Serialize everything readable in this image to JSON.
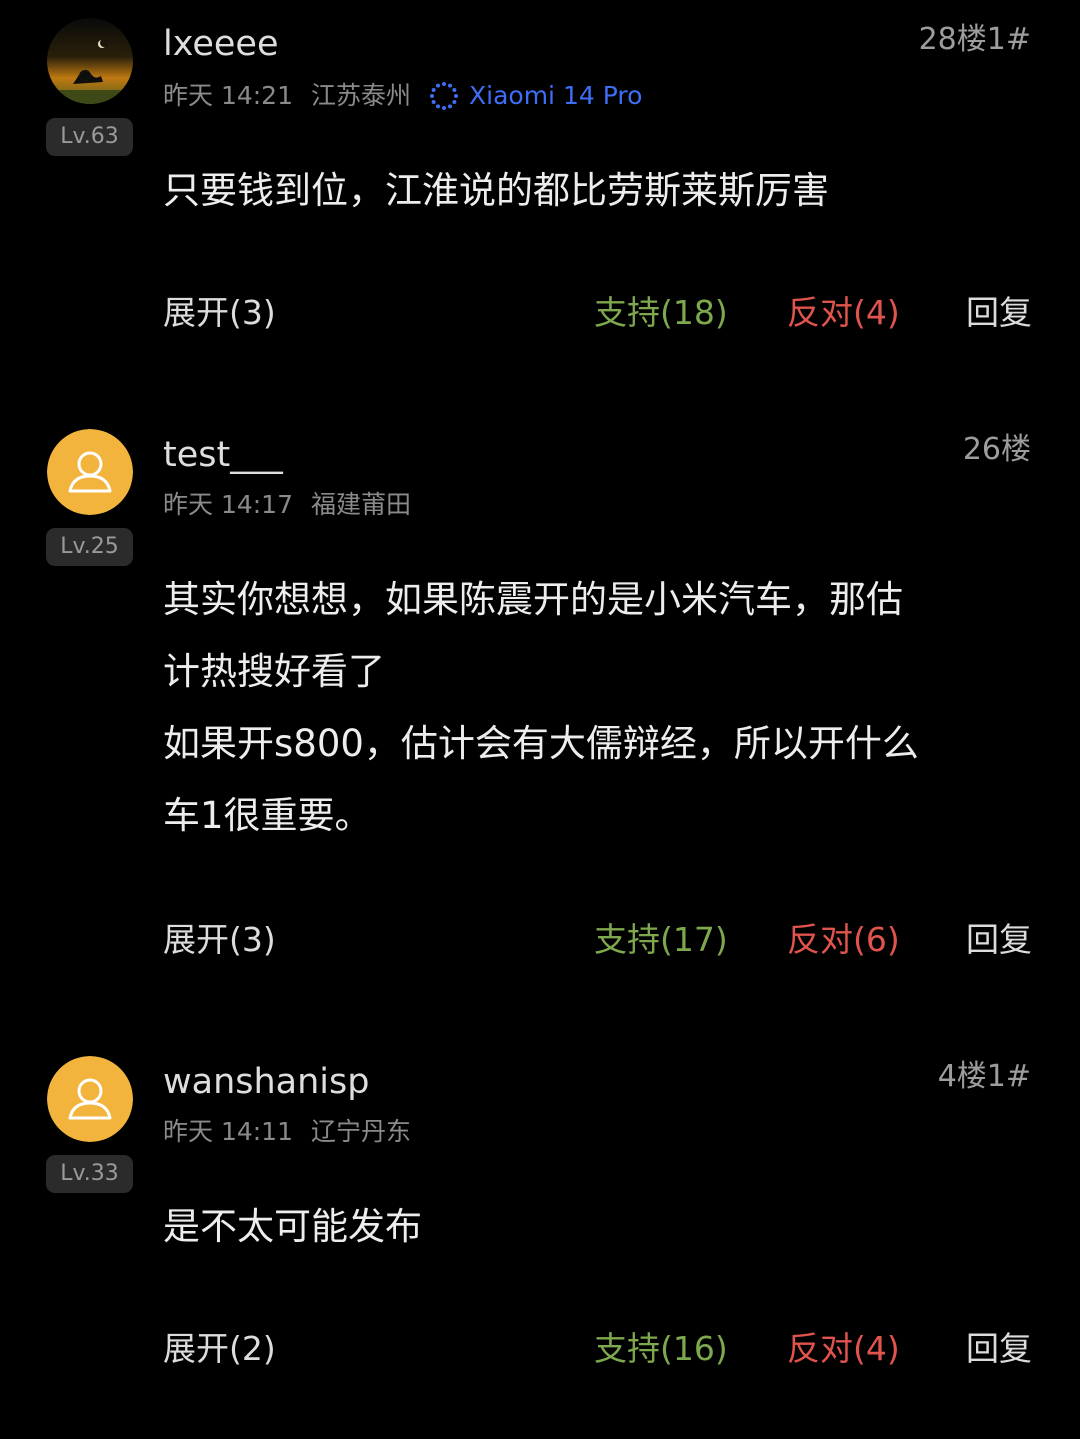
{
  "comments": [
    {
      "username": "lxeeee",
      "floor": "28楼1#",
      "time": "昨天 14:21",
      "location": "江苏泰州",
      "device": "Xiaomi 14 Pro",
      "level": "Lv.63",
      "avatar": "custom-photo-avatar",
      "content": [
        "只要钱到位，江淮说的都比劳斯莱斯厉害"
      ],
      "expand": "展开(3)",
      "support": "支持(18)",
      "oppose": "反对(4)",
      "reply": "回复"
    },
    {
      "username": "test___",
      "floor": "26楼",
      "time": "昨天 14:17",
      "location": "福建莆田",
      "level": "Lv.25",
      "avatar": "default-user-icon",
      "content": [
        "其实你想想，如果陈震开的是小米汽车，那估",
        "计热搜好看了",
        "如果开s800，估计会有大儒辩经，所以开什么",
        "车1很重要。"
      ],
      "expand": "展开(3)",
      "support": "支持(17)",
      "oppose": "反对(6)",
      "reply": "回复"
    },
    {
      "username": "wanshanisp",
      "floor": "4楼1#",
      "time": "昨天 14:11",
      "location": "辽宁丹东",
      "level": "Lv.33",
      "avatar": "default-user-icon",
      "content": [
        "是不太可能发布"
      ],
      "expand": "展开(2)",
      "support": "支持(16)",
      "oppose": "反对(4)",
      "reply": "回复"
    }
  ],
  "colors": {
    "background": "#000000",
    "support": "#7ea84d",
    "oppose": "#e0544d",
    "device": "#3d6ef5",
    "avatar_default": "#f2b43d"
  }
}
